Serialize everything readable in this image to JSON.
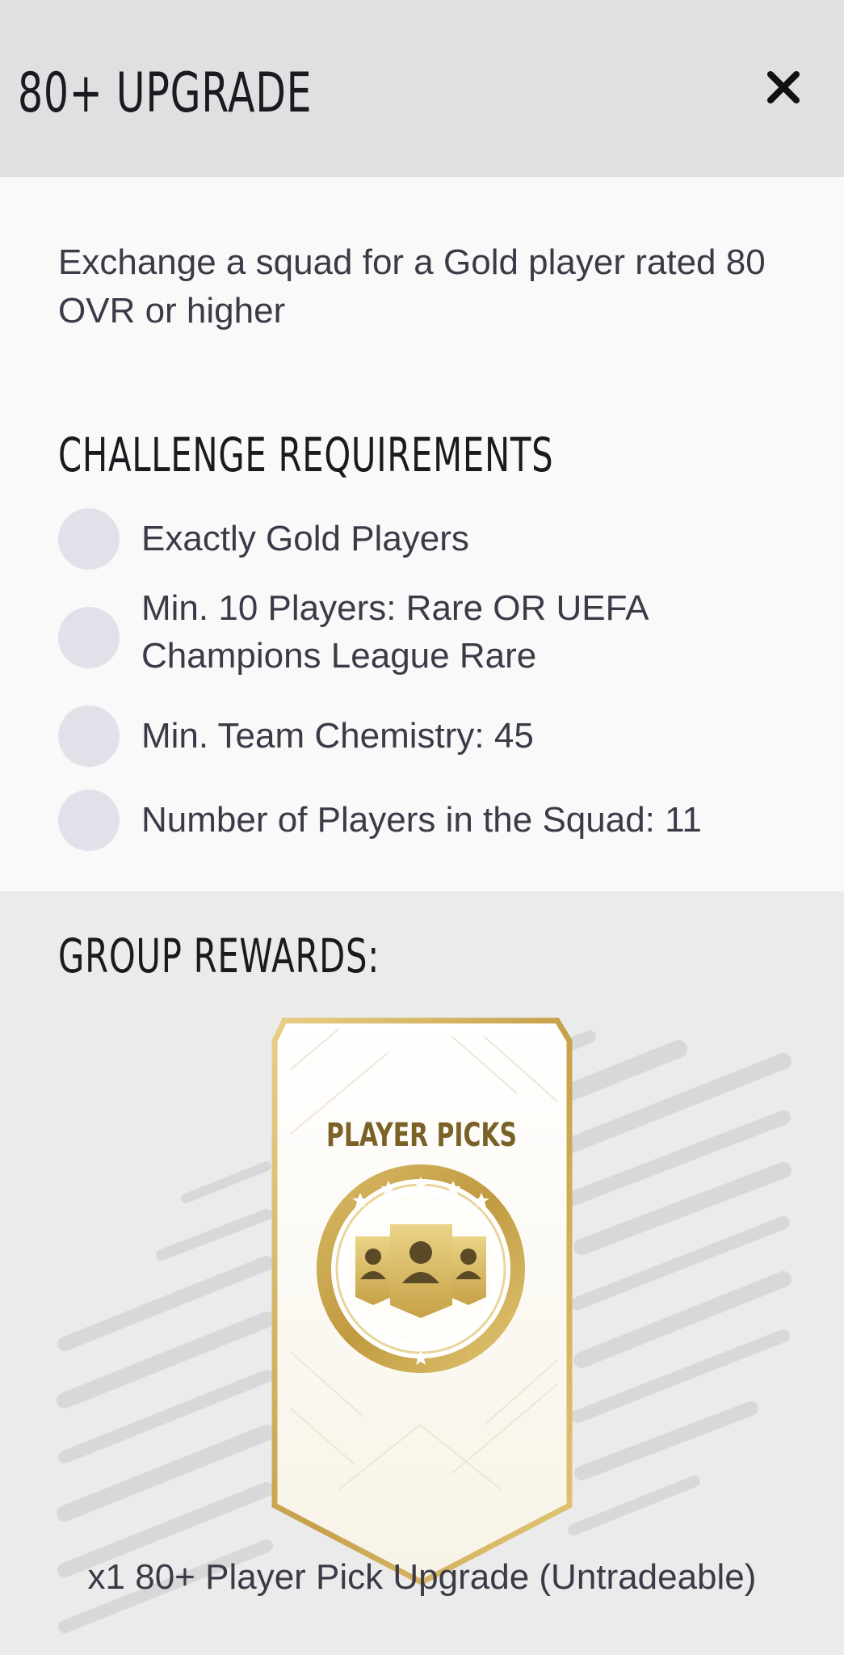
{
  "header": {
    "title": "80+ UPGRADE",
    "close_icon": "close-icon"
  },
  "description": "Exchange a squad for a Gold player rated 80 OVR or higher",
  "requirements": {
    "title": "CHALLENGE REQUIREMENTS",
    "items": [
      {
        "label": "Exactly Gold Players",
        "completed": false
      },
      {
        "label": "Min. 10 Players: Rare OR UEFA Champions League Rare",
        "completed": false
      },
      {
        "label": "Min. Team Chemistry: 45",
        "completed": false
      },
      {
        "label": "Number of Players in the Squad: 11",
        "completed": false
      }
    ]
  },
  "rewards": {
    "title": "GROUP REWARDS:",
    "pack": {
      "title": "PLAYER PICKS",
      "icon": "player-picks-icon"
    },
    "label": "x1 80+ Player Pick Upgrade (Untradeable)"
  },
  "colors": {
    "header_bg": "#e0e0e2",
    "panel_bg": "#f9f9fa",
    "rewards_bg": "#ebebec",
    "text": "#3a3b47",
    "heading": "#1b1b1f",
    "check_circle": "#e1e1ea",
    "gold": "#c9a64a",
    "gold_text": "#7a6226"
  }
}
